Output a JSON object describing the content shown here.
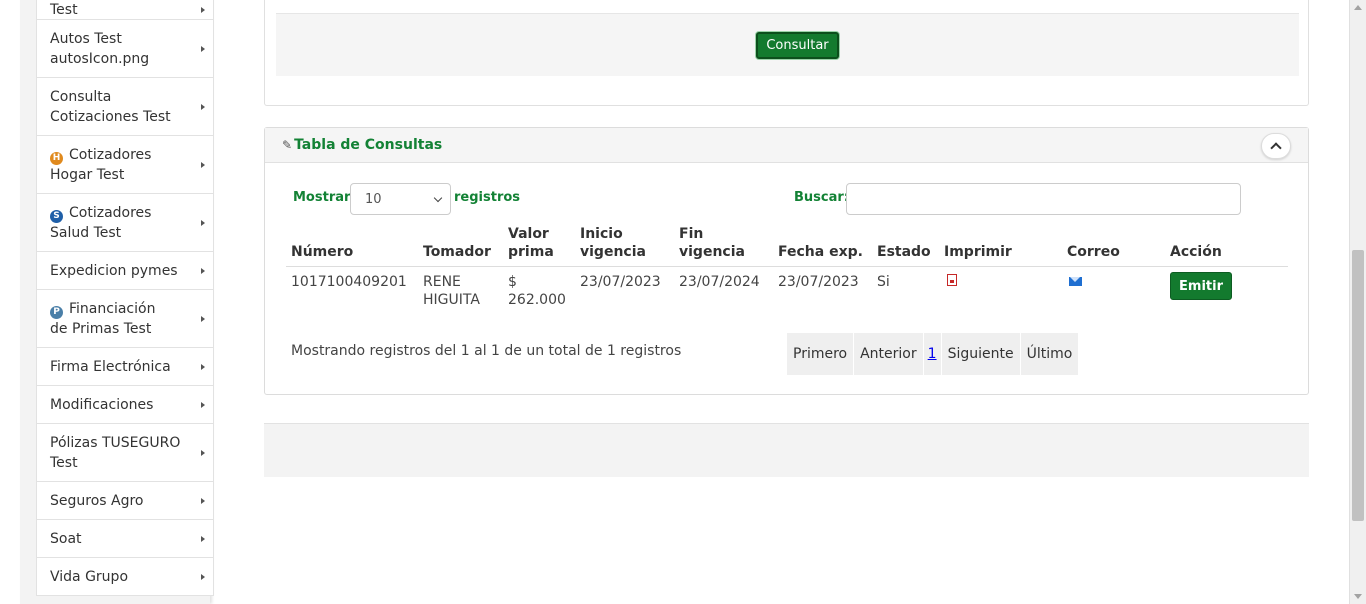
{
  "sidebar": {
    "items": [
      {
        "lines": [
          "Test"
        ],
        "icon": null
      },
      {
        "lines": [
          "Autos Test",
          "autosIcon.png"
        ],
        "icon": null
      },
      {
        "lines": [
          "Consulta",
          "Cotizaciones Test"
        ],
        "icon": null
      },
      {
        "lines": [
          "Cotizadores",
          "Hogar Test"
        ],
        "icon": {
          "name": "hogar-icon",
          "glyph": "H",
          "color": "#e08a1e"
        }
      },
      {
        "lines": [
          "Cotizadores",
          "Salud Test"
        ],
        "icon": {
          "name": "salud-icon",
          "glyph": "S",
          "color": "#1f5fa8"
        }
      },
      {
        "lines": [
          "Expedicion pymes"
        ],
        "icon": null
      },
      {
        "lines": [
          "Financiación",
          "de Primas Test"
        ],
        "icon": {
          "name": "financiacion-icon",
          "glyph": "P",
          "color": "#4a7fa8"
        }
      },
      {
        "lines": [
          "Firma Electrónica"
        ],
        "icon": null
      },
      {
        "lines": [
          "Modificaciones"
        ],
        "icon": null
      },
      {
        "lines": [
          "Pólizas TUSEGURO",
          "Test"
        ],
        "icon": null
      },
      {
        "lines": [
          "Seguros Agro"
        ],
        "icon": null
      },
      {
        "lines": [
          "Soat"
        ],
        "icon": null
      },
      {
        "lines": [
          "Vida Grupo"
        ],
        "icon": null
      }
    ]
  },
  "top": {
    "consultar_label": "Consultar"
  },
  "table_panel": {
    "title": "Tabla de Consultas",
    "show_label": "Mostrar",
    "page_size": "10",
    "records_label": "registros",
    "search_label": "Buscar:",
    "search_value": "",
    "columns": [
      {
        "lines": [
          "Número"
        ]
      },
      {
        "lines": [
          "Tomador"
        ]
      },
      {
        "lines": [
          "Valor",
          "prima"
        ]
      },
      {
        "lines": [
          "Inicio",
          "vigencia"
        ]
      },
      {
        "lines": [
          "Fin",
          "vigencia"
        ]
      },
      {
        "lines": [
          "Fecha exp."
        ]
      },
      {
        "lines": [
          "Estado"
        ]
      },
      {
        "lines": [
          "Imprimir"
        ]
      },
      {
        "lines": [
          "Correo"
        ]
      },
      {
        "lines": [
          "Acción"
        ]
      }
    ],
    "rows": [
      {
        "numero": "1017100409201",
        "tomador": [
          "RENE",
          "HIGUITA"
        ],
        "valor_prima": [
          "$",
          "262.000"
        ],
        "inicio_vigencia": "23/07/2023",
        "fin_vigencia": "23/07/2024",
        "fecha_exp": "23/07/2023",
        "estado": "Si",
        "imprimir_icon": "pdf-icon",
        "correo_icon": "mail-icon",
        "accion_label": "Emitir"
      }
    ],
    "info": "Mostrando registros del 1 al 1 de un total de 1 registros",
    "pager": {
      "first": "Primero",
      "prev": "Anterior",
      "current": "1",
      "next": "Siguiente",
      "last": "Último"
    }
  },
  "colors": {
    "brand_green": "#137a2e",
    "label_green": "#138235"
  }
}
